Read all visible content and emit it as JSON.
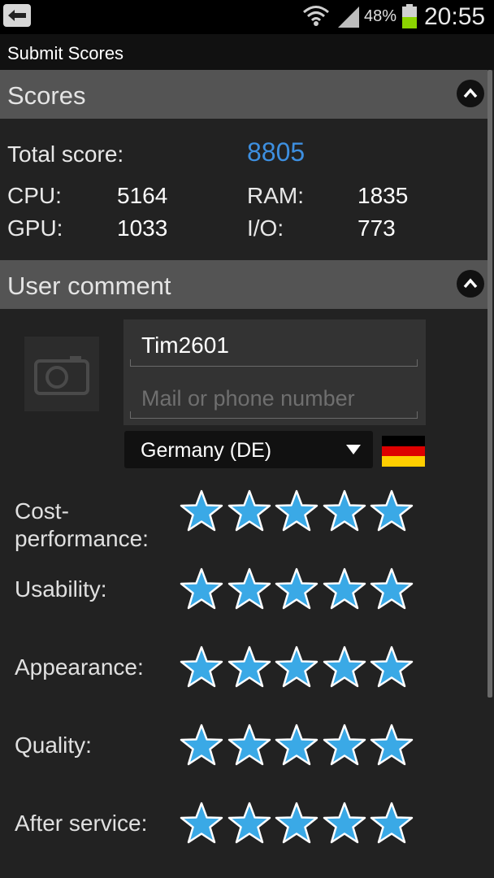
{
  "status_bar": {
    "battery_percent": "48%",
    "time": "20:55",
    "icons": [
      "back-icon",
      "wifi-icon",
      "signal-icon",
      "battery-icon"
    ]
  },
  "title_bar": {
    "title": "Submit Scores"
  },
  "scores_section": {
    "header": "Scores",
    "total_label": "Total score:",
    "total_value": "8805",
    "cpu_label": "CPU:",
    "cpu_value": "5164",
    "gpu_label": "GPU:",
    "gpu_value": "1033",
    "ram_label": "RAM:",
    "ram_value": "1835",
    "io_label": "I/O:",
    "io_value": "773"
  },
  "comment_section": {
    "header": "User comment",
    "name_value": "Tim2601",
    "contact_placeholder": "Mail or phone number",
    "country_selected": "Germany (DE)",
    "ratings": [
      {
        "label": "Cost-\nperformance:",
        "stars": 5,
        "max": 5
      },
      {
        "label": "Usability:",
        "stars": 5,
        "max": 5
      },
      {
        "label": "Appearance:",
        "stars": 5,
        "max": 5
      },
      {
        "label": "Quality:",
        "stars": 5,
        "max": 5
      },
      {
        "label": "After service:",
        "stars": 5,
        "max": 5
      }
    ]
  },
  "colors": {
    "accent_blue": "#3d8fe0",
    "star_fill": "#3aa9e6",
    "flag_black": "#000000",
    "flag_red": "#dd0000",
    "flag_gold": "#ffce00"
  }
}
